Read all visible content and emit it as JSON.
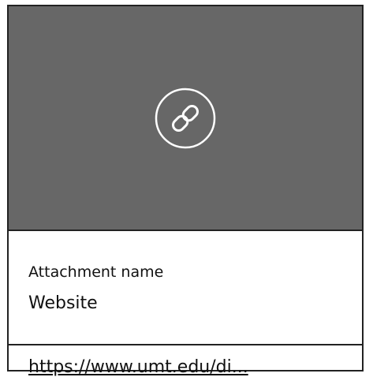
{
  "attachment": {
    "icon": "link-icon",
    "preview_color": "#676767",
    "name_label": "Attachment name",
    "name_value": "Website",
    "url_text": "https://www.umt.edu/di..."
  }
}
